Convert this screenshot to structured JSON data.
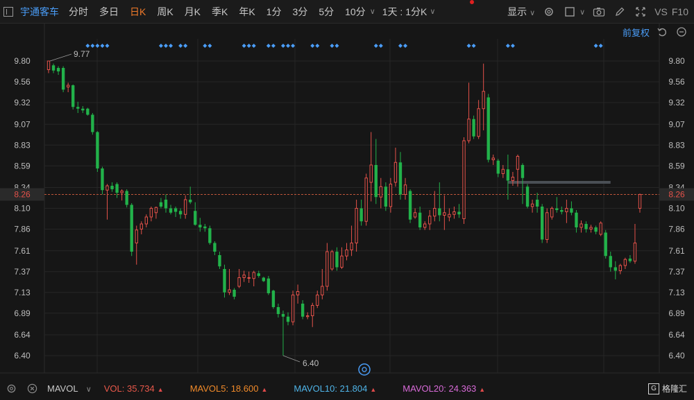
{
  "toolbar": {
    "stock_name": "宇通客车",
    "periods": [
      "分时",
      "多日",
      "日K",
      "周K",
      "月K",
      "季K",
      "年K",
      "1分",
      "3分",
      "5分",
      "10分"
    ],
    "active_period": "日K",
    "range_select": "1天 : 1分K",
    "display": "显示",
    "vs": "VS",
    "f10": "F10"
  },
  "sub_toolbar": {
    "adjust": "前复权"
  },
  "chart_data": {
    "type": "candlestick",
    "y_ticks": [
      "9.80",
      "9.56",
      "9.32",
      "9.07",
      "8.83",
      "8.59",
      "8.34",
      "8.10",
      "7.86",
      "7.61",
      "7.37",
      "7.13",
      "6.89",
      "6.64",
      "6.40"
    ],
    "ylim": [
      6.29,
      9.93
    ],
    "current_price": "8.26",
    "high_label": "9.77",
    "low_label": "6.40",
    "candles": [
      {
        "o": 9.7,
        "h": 9.8,
        "l": 9.66,
        "c": 9.8
      },
      {
        "o": 9.75,
        "h": 9.77,
        "l": 9.66,
        "c": 9.69
      },
      {
        "o": 9.72,
        "h": 9.74,
        "l": 9.64,
        "c": 9.68
      },
      {
        "o": 9.72,
        "h": 9.74,
        "l": 9.44,
        "c": 9.47
      },
      {
        "o": 9.5,
        "h": 9.55,
        "l": 9.44,
        "c": 9.52
      },
      {
        "o": 9.52,
        "h": 9.53,
        "l": 9.24,
        "c": 9.27
      },
      {
        "o": 9.27,
        "h": 9.33,
        "l": 9.2,
        "c": 9.25
      },
      {
        "o": 9.25,
        "h": 9.28,
        "l": 9.2,
        "c": 9.23
      },
      {
        "o": 9.25,
        "h": 9.26,
        "l": 9.17,
        "c": 9.18
      },
      {
        "o": 9.18,
        "h": 9.2,
        "l": 8.95,
        "c": 8.98
      },
      {
        "o": 8.98,
        "h": 8.99,
        "l": 8.52,
        "c": 8.56
      },
      {
        "o": 8.56,
        "h": 8.58,
        "l": 8.26,
        "c": 8.31
      },
      {
        "o": 8.31,
        "h": 8.38,
        "l": 7.97,
        "c": 8.36
      },
      {
        "o": 8.36,
        "h": 8.4,
        "l": 8.29,
        "c": 8.32
      },
      {
        "o": 8.38,
        "h": 8.4,
        "l": 8.22,
        "c": 8.28
      },
      {
        "o": 8.28,
        "h": 8.32,
        "l": 8.19,
        "c": 8.3
      },
      {
        "o": 8.3,
        "h": 8.32,
        "l": 8.11,
        "c": 8.14
      },
      {
        "o": 8.14,
        "h": 8.16,
        "l": 7.55,
        "c": 7.6
      },
      {
        "o": 7.7,
        "h": 7.9,
        "l": 7.45,
        "c": 7.85
      },
      {
        "o": 7.86,
        "h": 7.95,
        "l": 7.8,
        "c": 7.92
      },
      {
        "o": 7.92,
        "h": 8.03,
        "l": 7.88,
        "c": 8.0
      },
      {
        "o": 8.0,
        "h": 8.12,
        "l": 7.95,
        "c": 8.1
      },
      {
        "o": 8.05,
        "h": 8.12,
        "l": 7.98,
        "c": 8.11
      },
      {
        "o": 8.17,
        "h": 8.22,
        "l": 8.1,
        "c": 8.12
      },
      {
        "o": 8.2,
        "h": 8.26,
        "l": 8.05,
        "c": 8.1
      },
      {
        "o": 8.1,
        "h": 8.14,
        "l": 8.03,
        "c": 8.05
      },
      {
        "o": 8.1,
        "h": 8.12,
        "l": 8.0,
        "c": 8.06
      },
      {
        "o": 8.07,
        "h": 8.1,
        "l": 7.98,
        "c": 8.03
      },
      {
        "o": 8.03,
        "h": 8.25,
        "l": 7.98,
        "c": 8.2
      },
      {
        "o": 8.2,
        "h": 8.35,
        "l": 8.15,
        "c": 8.17
      },
      {
        "o": 8.07,
        "h": 8.17,
        "l": 7.9,
        "c": 7.91
      },
      {
        "o": 7.91,
        "h": 7.99,
        "l": 7.83,
        "c": 7.88
      },
      {
        "o": 7.89,
        "h": 7.92,
        "l": 7.83,
        "c": 7.87
      },
      {
        "o": 7.87,
        "h": 7.9,
        "l": 7.68,
        "c": 7.7
      },
      {
        "o": 7.7,
        "h": 7.72,
        "l": 7.56,
        "c": 7.6
      },
      {
        "o": 7.56,
        "h": 7.6,
        "l": 7.4,
        "c": 7.43
      },
      {
        "o": 7.4,
        "h": 7.45,
        "l": 7.07,
        "c": 7.13
      },
      {
        "o": 7.13,
        "h": 7.4,
        "l": 7.1,
        "c": 7.16
      },
      {
        "o": 7.16,
        "h": 7.18,
        "l": 7.05,
        "c": 7.08
      },
      {
        "o": 7.2,
        "h": 7.4,
        "l": 7.18,
        "c": 7.3
      },
      {
        "o": 7.3,
        "h": 7.38,
        "l": 7.25,
        "c": 7.33
      },
      {
        "o": 7.3,
        "h": 7.37,
        "l": 7.24,
        "c": 7.3
      },
      {
        "o": 7.29,
        "h": 7.38,
        "l": 7.2,
        "c": 7.36
      },
      {
        "o": 7.35,
        "h": 7.38,
        "l": 7.3,
        "c": 7.32
      },
      {
        "o": 7.3,
        "h": 7.31,
        "l": 7.25,
        "c": 7.26
      },
      {
        "o": 7.29,
        "h": 7.32,
        "l": 7.1,
        "c": 7.12
      },
      {
        "o": 7.15,
        "h": 7.16,
        "l": 6.94,
        "c": 6.96
      },
      {
        "o": 6.96,
        "h": 7.0,
        "l": 6.84,
        "c": 6.88
      },
      {
        "o": 6.88,
        "h": 6.92,
        "l": 6.4,
        "c": 6.85
      },
      {
        "o": 6.85,
        "h": 6.9,
        "l": 6.75,
        "c": 6.79
      },
      {
        "o": 6.79,
        "h": 7.15,
        "l": 6.75,
        "c": 7.1
      },
      {
        "o": 7.1,
        "h": 7.22,
        "l": 7.0,
        "c": 7.14
      },
      {
        "o": 7.0,
        "h": 7.04,
        "l": 6.82,
        "c": 6.85
      },
      {
        "o": 6.85,
        "h": 6.9,
        "l": 6.82,
        "c": 6.86
      },
      {
        "o": 6.86,
        "h": 7.01,
        "l": 6.73,
        "c": 6.98
      },
      {
        "o": 6.98,
        "h": 7.15,
        "l": 6.95,
        "c": 7.1
      },
      {
        "o": 7.1,
        "h": 7.4,
        "l": 7.05,
        "c": 7.2
      },
      {
        "o": 7.2,
        "h": 7.7,
        "l": 7.15,
        "c": 7.6
      },
      {
        "o": 7.4,
        "h": 7.62,
        "l": 7.38,
        "c": 7.6
      },
      {
        "o": 7.6,
        "h": 7.65,
        "l": 7.38,
        "c": 7.42
      },
      {
        "o": 7.42,
        "h": 7.65,
        "l": 7.4,
        "c": 7.55
      },
      {
        "o": 7.55,
        "h": 7.7,
        "l": 7.5,
        "c": 7.62
      },
      {
        "o": 7.62,
        "h": 7.9,
        "l": 7.55,
        "c": 7.7
      },
      {
        "o": 7.7,
        "h": 8.2,
        "l": 7.6,
        "c": 8.1
      },
      {
        "o": 8.1,
        "h": 8.2,
        "l": 7.9,
        "c": 7.95
      },
      {
        "o": 7.95,
        "h": 8.5,
        "l": 7.9,
        "c": 8.45
      },
      {
        "o": 8.4,
        "h": 8.98,
        "l": 8.18,
        "c": 8.6
      },
      {
        "o": 8.6,
        "h": 8.9,
        "l": 8.15,
        "c": 8.23
      },
      {
        "o": 8.23,
        "h": 8.45,
        "l": 8.1,
        "c": 8.35
      },
      {
        "o": 8.35,
        "h": 8.4,
        "l": 8.07,
        "c": 8.12
      },
      {
        "o": 8.12,
        "h": 8.45,
        "l": 8.05,
        "c": 8.38
      },
      {
        "o": 8.4,
        "h": 8.8,
        "l": 8.35,
        "c": 8.63
      },
      {
        "o": 8.63,
        "h": 8.75,
        "l": 8.2,
        "c": 8.26
      },
      {
        "o": 8.26,
        "h": 8.45,
        "l": 8.2,
        "c": 8.37
      },
      {
        "o": 8.3,
        "h": 8.32,
        "l": 7.93,
        "c": 7.97
      },
      {
        "o": 8.0,
        "h": 8.1,
        "l": 7.98,
        "c": 8.05
      },
      {
        "o": 8.05,
        "h": 8.12,
        "l": 7.85,
        "c": 7.88
      },
      {
        "o": 7.88,
        "h": 7.95,
        "l": 7.85,
        "c": 7.92
      },
      {
        "o": 7.92,
        "h": 8.08,
        "l": 7.85,
        "c": 8.01
      },
      {
        "o": 8.01,
        "h": 8.3,
        "l": 7.95,
        "c": 8.1
      },
      {
        "o": 8.1,
        "h": 8.4,
        "l": 7.95,
        "c": 8.02
      },
      {
        "o": 8.02,
        "h": 8.25,
        "l": 7.85,
        "c": 8.05
      },
      {
        "o": 8.0,
        "h": 8.1,
        "l": 7.95,
        "c": 8.03
      },
      {
        "o": 8.03,
        "h": 8.12,
        "l": 7.98,
        "c": 8.06
      },
      {
        "o": 8.06,
        "h": 8.15,
        "l": 7.99,
        "c": 8.03
      },
      {
        "o": 7.98,
        "h": 8.92,
        "l": 7.92,
        "c": 8.88
      },
      {
        "o": 8.88,
        "h": 9.55,
        "l": 8.85,
        "c": 9.13
      },
      {
        "o": 9.13,
        "h": 9.17,
        "l": 8.9,
        "c": 8.93
      },
      {
        "o": 8.93,
        "h": 9.35,
        "l": 8.9,
        "c": 9.25
      },
      {
        "o": 9.25,
        "h": 9.77,
        "l": 9.0,
        "c": 9.45
      },
      {
        "o": 9.38,
        "h": 9.42,
        "l": 8.63,
        "c": 8.66
      },
      {
        "o": 8.66,
        "h": 8.72,
        "l": 8.6,
        "c": 8.68
      },
      {
        "o": 8.65,
        "h": 8.67,
        "l": 8.46,
        "c": 8.5
      },
      {
        "o": 8.5,
        "h": 8.6,
        "l": 8.45,
        "c": 8.55
      },
      {
        "o": 8.55,
        "h": 8.72,
        "l": 8.2,
        "c": 8.42
      },
      {
        "o": 8.42,
        "h": 8.52,
        "l": 8.36,
        "c": 8.46
      },
      {
        "o": 8.55,
        "h": 8.72,
        "l": 8.35,
        "c": 8.7
      },
      {
        "o": 8.6,
        "h": 8.62,
        "l": 8.15,
        "c": 8.45
      },
      {
        "o": 8.35,
        "h": 8.38,
        "l": 8.1,
        "c": 8.12
      },
      {
        "o": 8.12,
        "h": 8.2,
        "l": 8.05,
        "c": 8.15
      },
      {
        "o": 8.2,
        "h": 8.28,
        "l": 8.05,
        "c": 8.12
      },
      {
        "o": 8.12,
        "h": 8.15,
        "l": 7.7,
        "c": 7.74
      },
      {
        "o": 7.74,
        "h": 8.1,
        "l": 7.7,
        "c": 8.05
      },
      {
        "o": 8.0,
        "h": 8.12,
        "l": 7.97,
        "c": 8.1
      },
      {
        "o": 8.1,
        "h": 8.23,
        "l": 8.05,
        "c": 8.08
      },
      {
        "o": 8.08,
        "h": 8.12,
        "l": 8.03,
        "c": 8.06
      },
      {
        "o": 8.06,
        "h": 8.2,
        "l": 7.93,
        "c": 8.1
      },
      {
        "o": 8.1,
        "h": 8.18,
        "l": 8.02,
        "c": 8.05
      },
      {
        "o": 8.05,
        "h": 8.08,
        "l": 7.82,
        "c": 7.88
      },
      {
        "o": 7.88,
        "h": 7.96,
        "l": 7.82,
        "c": 7.92
      },
      {
        "o": 7.92,
        "h": 7.95,
        "l": 7.82,
        "c": 7.86
      },
      {
        "o": 7.86,
        "h": 7.91,
        "l": 7.82,
        "c": 7.88
      },
      {
        "o": 7.88,
        "h": 7.9,
        "l": 7.8,
        "c": 7.83
      },
      {
        "o": 7.8,
        "h": 7.95,
        "l": 7.78,
        "c": 7.93
      },
      {
        "o": 7.82,
        "h": 7.85,
        "l": 7.52,
        "c": 7.55
      },
      {
        "o": 7.55,
        "h": 7.6,
        "l": 7.37,
        "c": 7.42
      },
      {
        "o": 7.42,
        "h": 7.49,
        "l": 7.28,
        "c": 7.38
      },
      {
        "o": 7.38,
        "h": 7.46,
        "l": 7.34,
        "c": 7.44
      },
      {
        "o": 7.44,
        "h": 7.53,
        "l": 7.4,
        "c": 7.51
      },
      {
        "o": 7.52,
        "h": 7.56,
        "l": 7.47,
        "c": 7.49
      },
      {
        "o": 7.49,
        "h": 7.92,
        "l": 7.46,
        "c": 7.7
      },
      {
        "o": 8.1,
        "h": 8.27,
        "l": 8.05,
        "c": 8.26
      }
    ],
    "event_markers": [
      8,
      9,
      10,
      11,
      12,
      23,
      24,
      25,
      27,
      28,
      32,
      33,
      40,
      41,
      42,
      45,
      46,
      48,
      49,
      50,
      54,
      55,
      58,
      59,
      67,
      68,
      72,
      73,
      86,
      87,
      94,
      95,
      112,
      113
    ],
    "resistance_line": {
      "price": 8.4,
      "from": 94,
      "to": 115
    }
  },
  "bottom": {
    "indicator": "MAVOL",
    "vol": "VOL: 35.734",
    "mavol5": "MAVOL5: 18.600",
    "mavol10": "MAVOL10: 21.804",
    "mavol20": "MAVOL20: 24.363",
    "colors": {
      "vol": "#e8584a",
      "mavol5": "#f08a2a",
      "mavol10": "#4fb4e8",
      "mavol20": "#d86ad8"
    }
  },
  "logo": {
    "text": "格隆汇"
  },
  "colors": {
    "up": "#e5524a",
    "down": "#22b24a",
    "accent": "#4a9df8",
    "bg": "#161616"
  }
}
